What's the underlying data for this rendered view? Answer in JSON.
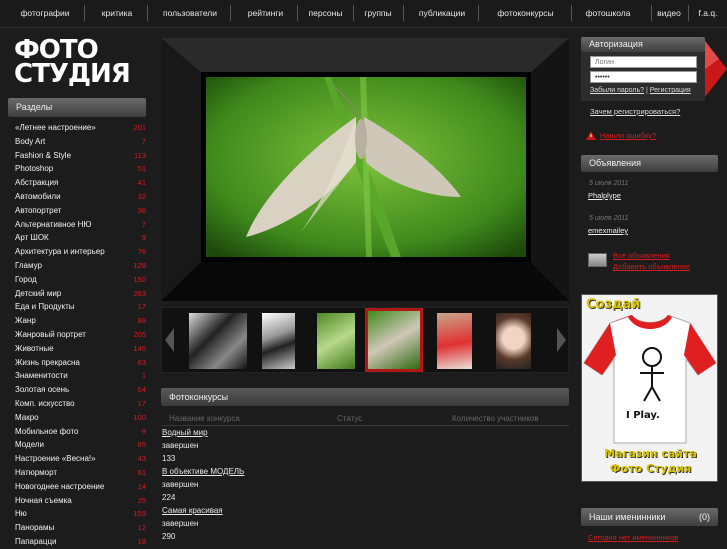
{
  "nav": {
    "items": [
      "фотографии",
      "критика",
      "пользователи",
      "рейтинги",
      "персоны",
      "группы",
      "публикации",
      "фотоконкурсы",
      "фотошкола",
      "видео",
      "f.a.q."
    ]
  },
  "logo": {
    "line1": "ФОТО",
    "line2": "СТУДИЯ"
  },
  "sections": {
    "title": "Разделы",
    "items": [
      {
        "label": "«Летнее настроение»",
        "count": "201"
      },
      {
        "label": "Body Art",
        "count": "7"
      },
      {
        "label": "Fashion & Style",
        "count": "113"
      },
      {
        "label": "Photoshop",
        "count": "51"
      },
      {
        "label": "Абстракция",
        "count": "41"
      },
      {
        "label": "Автомобили",
        "count": "32"
      },
      {
        "label": "Автопортрет",
        "count": "36"
      },
      {
        "label": "Альтернативное НЮ",
        "count": "7"
      },
      {
        "label": "Арт ШОК",
        "count": "9"
      },
      {
        "label": "Архитектура и интерьер",
        "count": "76"
      },
      {
        "label": "Гламур",
        "count": "128"
      },
      {
        "label": "Город",
        "count": "150"
      },
      {
        "label": "Детский мир",
        "count": "263"
      },
      {
        "label": "Еда и Продукты",
        "count": "17"
      },
      {
        "label": "Жанр",
        "count": "88"
      },
      {
        "label": "Жанровый портрет",
        "count": "205"
      },
      {
        "label": "Животные",
        "count": "146"
      },
      {
        "label": "Жизнь прекрасна",
        "count": "63"
      },
      {
        "label": "Знаменитости",
        "count": "1"
      },
      {
        "label": "Золотая осень",
        "count": "64"
      },
      {
        "label": "Комп. искусство",
        "count": "17"
      },
      {
        "label": "Макро",
        "count": "100"
      },
      {
        "label": "Мобильное фото",
        "count": "9"
      },
      {
        "label": "Модели",
        "count": "85"
      },
      {
        "label": "Настроение «Весна!»",
        "count": "43"
      },
      {
        "label": "Натюрморт",
        "count": "61"
      },
      {
        "label": "Новогоднее настроение",
        "count": "14"
      },
      {
        "label": "Ночная съемка",
        "count": "25"
      },
      {
        "label": "Ню",
        "count": "159"
      },
      {
        "label": "Панорамы",
        "count": "12"
      },
      {
        "label": "Папарацци",
        "count": "18"
      }
    ]
  },
  "contests": {
    "title": "Фотоконкурсы",
    "columns": [
      "Название конкурса",
      "Статус",
      "Количество участников"
    ],
    "rows": [
      {
        "name": "Водный мир",
        "status": "завершен",
        "participants": "133"
      },
      {
        "name": "В объективе МОДЕЛЬ",
        "status": "завершен",
        "participants": "224"
      },
      {
        "name": "Самая красивая",
        "status": "завершен",
        "participants": "290"
      }
    ]
  },
  "auth": {
    "title": "Авторизация",
    "login_placeholder": "Логин",
    "password_value": "••••••",
    "forgot": "Забыли пароль?",
    "divider": "|",
    "register": "Регистрация",
    "why": "Зачем регистрироваться?",
    "report": "Нашли ошибку?"
  },
  "ads": {
    "title": "Объявления",
    "entries": [
      {
        "date": "5 июля 2011",
        "user": "Phalplype"
      },
      {
        "date": "5 июля 2011",
        "user": "emexmailey"
      }
    ],
    "all": "Все объявления",
    "add": "Добавить объявление"
  },
  "banner": {
    "top": "Создай",
    "shirt_text": "I Play.",
    "bottom1": "Магазин сайта",
    "bottom2": "Фото Студия"
  },
  "birthdays": {
    "title": "Наши именинники",
    "count": "(0)",
    "text": "Сегодня нет именинников"
  },
  "colors": {
    "accent": "#d21f1f",
    "background": "#1c1c1c"
  }
}
